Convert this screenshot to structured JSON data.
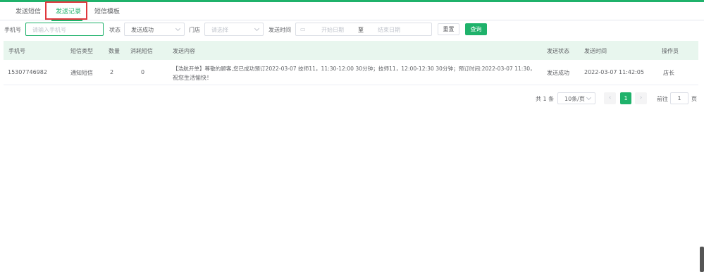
{
  "tabs": [
    {
      "label": "发送短信",
      "active": false
    },
    {
      "label": "发送记录",
      "active": true
    },
    {
      "label": "短信模板",
      "active": false
    }
  ],
  "filters": {
    "phone_label": "手机号",
    "phone_placeholder": "请输入手机号",
    "status_label": "状态",
    "status_value": "发送成功",
    "store_label": "门店",
    "store_placeholder": "请选择",
    "time_label": "发送时间",
    "start_placeholder": "开始日期",
    "range_sep": "至",
    "end_placeholder": "结束日期",
    "reset_label": "重置",
    "search_label": "查询"
  },
  "table": {
    "headers": [
      "手机号",
      "短信类型",
      "数量",
      "消耗短信",
      "发送内容",
      "发送状态",
      "发送时间",
      "操作员"
    ],
    "rows": [
      {
        "phone": "15307746982",
        "type": "通知短信",
        "count": "2",
        "consumed": "0",
        "content_line1": "【浩航开单】尊敬的顾客,您已成功预订2022-03-07 技师11，11:30-12:00 30分钟；技师11，12:00-12:30 30分钟；预订时间:2022-03-07 11:30，",
        "content_line2": "祝您生活愉快！",
        "status": "发送成功",
        "time": "2022-03-07 11:42:05",
        "operator": "店长"
      }
    ]
  },
  "pagination": {
    "total_text": "共 1 条",
    "page_size": "10条/页",
    "prev": "‹",
    "current_page": "1",
    "next": "›",
    "goto_label": "前往",
    "goto_value": "1",
    "goto_suffix": "页"
  },
  "colors": {
    "accent": "#1fb26b",
    "highlight_box": "#e0373c",
    "header_bg": "#e8f6ee"
  }
}
